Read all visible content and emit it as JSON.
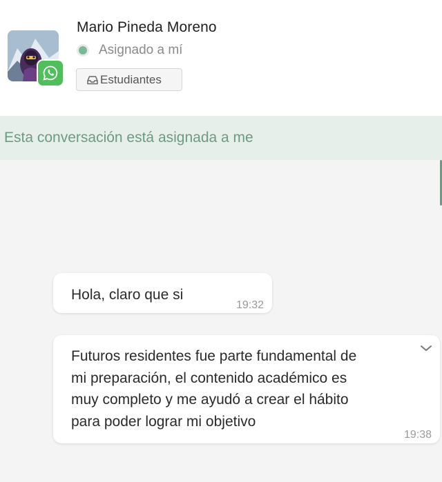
{
  "contact": {
    "name": "Mario Pineda Moreno",
    "status": "Asignado a mí",
    "inbox": "Estudiantes",
    "channel": "whatsapp"
  },
  "banner": {
    "text": "Esta conversación está asignada a me"
  },
  "messages": [
    {
      "text": "Hola, claro que si",
      "time": "19:32"
    },
    {
      "text": "Futuros residentes fue parte fundamental de\nmi preparación, el contenido académico es\nmuy completo y me ayudó a crear el hábito\npara poder lograr mi objetivo",
      "time": "19:38"
    }
  ],
  "icons": {
    "avatar": "avatar-illustration",
    "channel": "whatsapp-icon",
    "status": "status-dot-icon",
    "inbox": "inbox-icon",
    "message_menu": "chevron-down-icon"
  },
  "colors": {
    "accent_green": "#6d9a83",
    "banner_bg": "#e6efea",
    "whatsapp_green": "#4fbe5b",
    "status_green": "#7bb898"
  }
}
